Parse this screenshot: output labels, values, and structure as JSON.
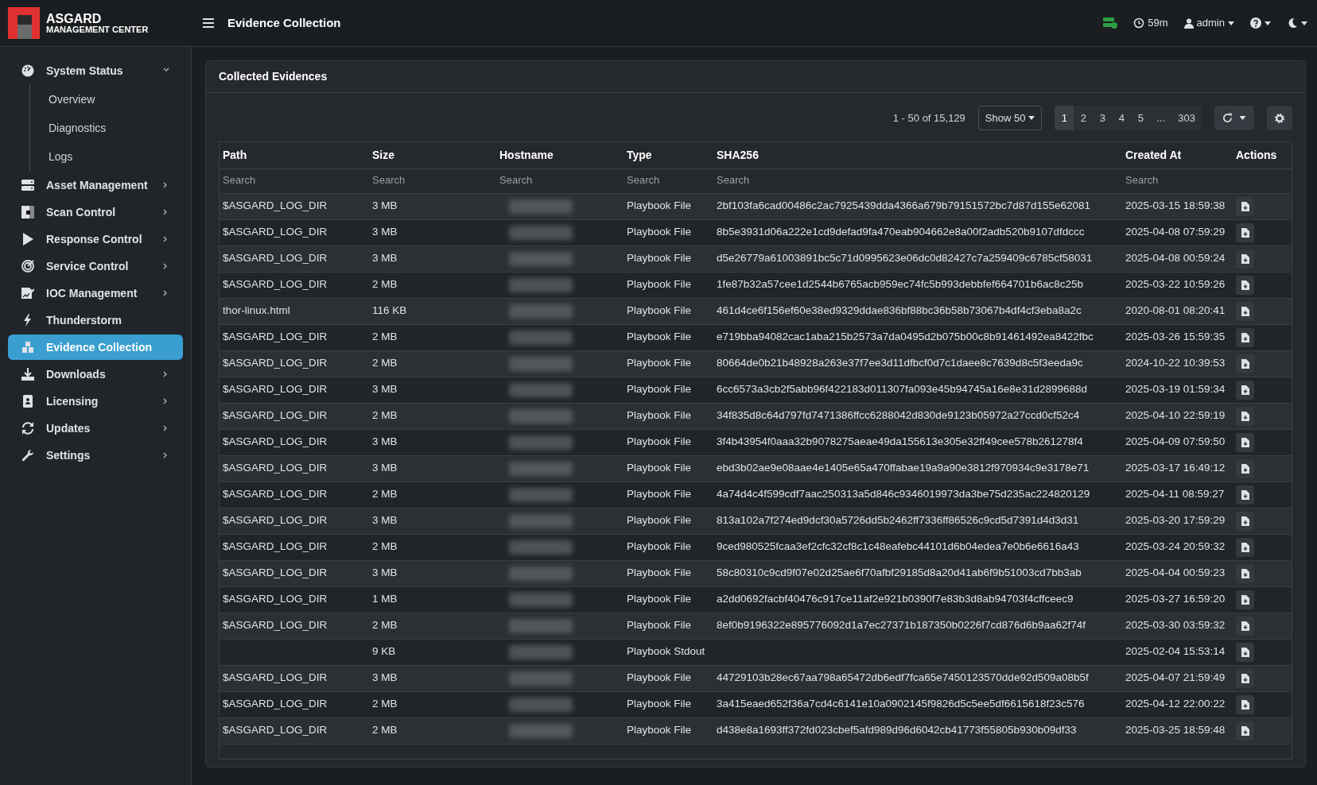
{
  "header": {
    "logo_title": "ASGARD",
    "logo_subtitle": "MANAGEMENT CENTER",
    "page_title": "Evidence Collection",
    "session_timer": "59m",
    "user": "admin"
  },
  "sidebar": {
    "items": [
      {
        "label": "System Status",
        "expanded": true,
        "selected": false,
        "children": [
          {
            "label": "Overview"
          },
          {
            "label": "Diagnostics"
          },
          {
            "label": "Logs"
          }
        ]
      },
      {
        "label": "Asset Management",
        "expanded": false,
        "selected": false
      },
      {
        "label": "Scan Control",
        "expanded": false,
        "selected": false
      },
      {
        "label": "Response Control",
        "expanded": false,
        "selected": false
      },
      {
        "label": "Service Control",
        "expanded": false,
        "selected": false
      },
      {
        "label": "IOC Management",
        "expanded": false,
        "selected": false
      },
      {
        "label": "Thunderstorm",
        "selected": false
      },
      {
        "label": "Evidence Collection",
        "selected": true
      },
      {
        "label": "Downloads",
        "expanded": false,
        "selected": false
      },
      {
        "label": "Licensing",
        "expanded": false,
        "selected": false
      },
      {
        "label": "Updates",
        "expanded": false,
        "selected": false
      },
      {
        "label": "Settings",
        "expanded": false,
        "selected": false
      }
    ]
  },
  "card": {
    "title": "Collected Evidences",
    "range": "1 - 50 of 15,129",
    "page_size": "Show 50",
    "pages": [
      {
        "label": "1",
        "selected": true
      },
      {
        "label": "2",
        "selected": false
      },
      {
        "label": "3",
        "selected": false
      },
      {
        "label": "4",
        "selected": false
      },
      {
        "label": "5",
        "selected": false
      },
      {
        "label": "...",
        "selected": false
      },
      {
        "label": "303",
        "selected": false
      }
    ]
  },
  "table": {
    "columns": [
      {
        "label": "Path",
        "placeholder": "Search"
      },
      {
        "label": "Size",
        "placeholder": "Search"
      },
      {
        "label": "Hostname",
        "placeholder": "Search"
      },
      {
        "label": "Type",
        "placeholder": "Search"
      },
      {
        "label": "SHA256",
        "placeholder": "Search"
      },
      {
        "label": "Created At",
        "placeholder": "Search"
      },
      {
        "label": "Actions"
      }
    ],
    "rows": [
      {
        "path": "$ASGARD_LOG_DIR",
        "size": "3 MB",
        "type": "Playbook File",
        "sha256": "2bf103fa6cad00486c2ac7925439dda4366a679b79151572bc7d87d155e62081",
        "created_at": "2025-03-15 18:59:38"
      },
      {
        "path": "$ASGARD_LOG_DIR",
        "size": "3 MB",
        "type": "Playbook File",
        "sha256": "8b5e3931d06a222e1cd9defad9fa470eab904662e8a00f2adb520b9107dfdccc",
        "created_at": "2025-04-08 07:59:29"
      },
      {
        "path": "$ASGARD_LOG_DIR",
        "size": "3 MB",
        "type": "Playbook File",
        "sha256": "d5e26779a61003891bc5c71d0995623e06dc0d82427c7a259409c6785cf58031",
        "created_at": "2025-04-08 00:59:24"
      },
      {
        "path": "$ASGARD_LOG_DIR",
        "size": "2 MB",
        "type": "Playbook File",
        "sha256": "1fe87b32a57cee1d2544b6765acb959ec74fc5b993debbfef664701b6ac8c25b",
        "created_at": "2025-03-22 10:59:26"
      },
      {
        "path": "thor-linux.html",
        "size": "116 KB",
        "type": "Playbook File",
        "sha256": "461d4ce6f156ef60e38ed9329ddae836bf88bc36b58b73067b4df4cf3eba8a2c",
        "created_at": "2020-08-01 08:20:41"
      },
      {
        "path": "$ASGARD_LOG_DIR",
        "size": "2 MB",
        "type": "Playbook File",
        "sha256": "e719bba94082cac1aba215b2573a7da0495d2b075b00c8b91461492ea8422fbc",
        "created_at": "2025-03-26 15:59:35"
      },
      {
        "path": "$ASGARD_LOG_DIR",
        "size": "2 MB",
        "type": "Playbook File",
        "sha256": "80664de0b21b48928a263e37f7ee3d11dfbcf0d7c1daee8c7639d8c5f3eeda9c",
        "created_at": "2024-10-22 10:39:53"
      },
      {
        "path": "$ASGARD_LOG_DIR",
        "size": "3 MB",
        "type": "Playbook File",
        "sha256": "6cc6573a3cb2f5abb96f422183d011307fa093e45b94745a16e8e31d2899688d",
        "created_at": "2025-03-19 01:59:34"
      },
      {
        "path": "$ASGARD_LOG_DIR",
        "size": "2 MB",
        "type": "Playbook File",
        "sha256": "34f835d8c64d797fd7471386ffcc6288042d830de9123b05972a27ccd0cf52c4",
        "created_at": "2025-04-10 22:59:19"
      },
      {
        "path": "$ASGARD_LOG_DIR",
        "size": "3 MB",
        "type": "Playbook File",
        "sha256": "3f4b43954f0aaa32b9078275aeae49da155613e305e32ff49cee578b261278f4",
        "created_at": "2025-04-09 07:59:50"
      },
      {
        "path": "$ASGARD_LOG_DIR",
        "size": "3 MB",
        "type": "Playbook File",
        "sha256": "ebd3b02ae9e08aae4e1405e65a470ffabae19a9a90e3812f970934c9e3178e71",
        "created_at": "2025-03-17 16:49:12"
      },
      {
        "path": "$ASGARD_LOG_DIR",
        "size": "2 MB",
        "type": "Playbook File",
        "sha256": "4a74d4c4f599cdf7aac250313a5d846c9346019973da3be75d235ac224820129",
        "created_at": "2025-04-11 08:59:27"
      },
      {
        "path": "$ASGARD_LOG_DIR",
        "size": "3 MB",
        "type": "Playbook File",
        "sha256": "813a102a7f274ed9dcf30a5726dd5b2462ff7336ff86526c9cd5d7391d4d3d31",
        "created_at": "2025-03-20 17:59:29"
      },
      {
        "path": "$ASGARD_LOG_DIR",
        "size": "2 MB",
        "type": "Playbook File",
        "sha256": "9ced980525fcaa3ef2cfc32cf8c1c48eafebc44101d6b04edea7e0b6e6616a43",
        "created_at": "2025-03-24 20:59:32"
      },
      {
        "path": "$ASGARD_LOG_DIR",
        "size": "3 MB",
        "type": "Playbook File",
        "sha256": "58c80310c9cd9f07e02d25ae6f70afbf29185d8a20d41ab6f9b51003cd7bb3ab",
        "created_at": "2025-04-04 00:59:23"
      },
      {
        "path": "$ASGARD_LOG_DIR",
        "size": "1 MB",
        "type": "Playbook File",
        "sha256": "a2dd0692facbf40476c917ce11af2e921b0390f7e83b3d8ab94703f4cffceec9",
        "created_at": "2025-03-27 16:59:20"
      },
      {
        "path": "$ASGARD_LOG_DIR",
        "size": "2 MB",
        "type": "Playbook File",
        "sha256": "8ef0b9196322e895776092d1a7ec27371b187350b0226f7cd876d6b9aa62f74f",
        "created_at": "2025-03-30 03:59:32"
      },
      {
        "size": "9 KB",
        "type": "Playbook Stdout",
        "created_at": "2025-02-04 15:53:14"
      },
      {
        "path": "$ASGARD_LOG_DIR",
        "size": "3 MB",
        "type": "Playbook File",
        "sha256": "44729103b28ec67aa798a65472db6edf7fca65e7450123570dde92d509a08b5f",
        "created_at": "2025-04-07 21:59:49"
      },
      {
        "path": "$ASGARD_LOG_DIR",
        "size": "2 MB",
        "type": "Playbook File",
        "sha256": "3a415eaed652f36a7cd4c6141e10a0902145f9826d5c5ee5df6615618f23c576",
        "created_at": "2025-04-12 22:00:22"
      },
      {
        "path": "$ASGARD_LOG_DIR",
        "size": "2 MB",
        "type": "Playbook File",
        "sha256": "d438e8a1693ff372fd023cbef5afd989d96d6042cb41773f55805b930b09df33",
        "created_at": "2025-03-25 18:59:48"
      }
    ]
  }
}
